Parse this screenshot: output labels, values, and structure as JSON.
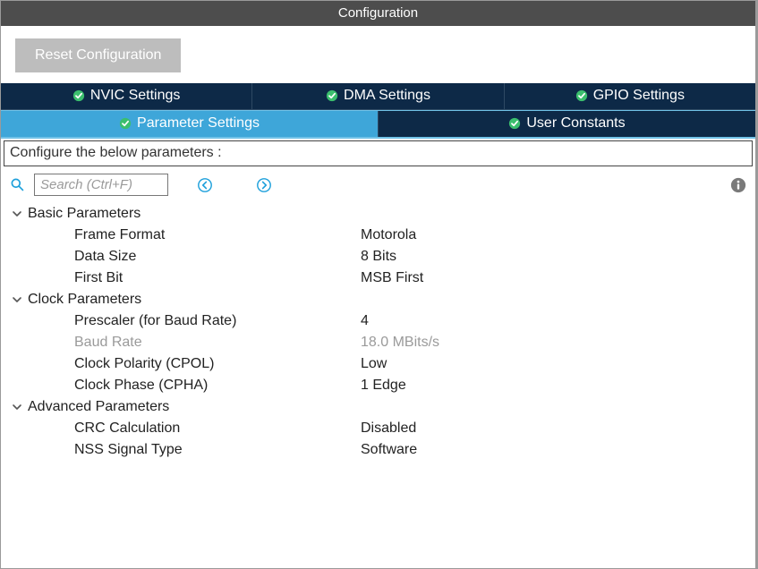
{
  "title": "Configuration",
  "toolbar": {
    "reset_label": "Reset Configuration"
  },
  "tabs": {
    "row1": [
      {
        "label": "NVIC Settings"
      },
      {
        "label": "DMA Settings"
      },
      {
        "label": "GPIO Settings"
      }
    ],
    "row2": [
      {
        "label": "Parameter Settings"
      },
      {
        "label": "User Constants"
      }
    ]
  },
  "prompt": "Configure the below parameters :",
  "search": {
    "placeholder": "Search (Ctrl+F)"
  },
  "groups": {
    "basic": {
      "title": "Basic Parameters",
      "frame_format": {
        "label": "Frame Format",
        "value": "Motorola"
      },
      "data_size": {
        "label": "Data Size",
        "value": "8 Bits"
      },
      "first_bit": {
        "label": "First Bit",
        "value": "MSB First"
      }
    },
    "clock": {
      "title": "Clock Parameters",
      "prescaler": {
        "label": "Prescaler (for Baud Rate)",
        "value": "4"
      },
      "baud_rate": {
        "label": "Baud Rate",
        "value": "18.0 MBits/s"
      },
      "cpol": {
        "label": "Clock Polarity (CPOL)",
        "value": "Low"
      },
      "cpha": {
        "label": "Clock Phase (CPHA)",
        "value": "1 Edge"
      }
    },
    "advanced": {
      "title": "Advanced Parameters",
      "crc": {
        "label": "CRC Calculation",
        "value": "Disabled"
      },
      "nss": {
        "label": "NSS Signal Type",
        "value": "Software"
      }
    }
  }
}
